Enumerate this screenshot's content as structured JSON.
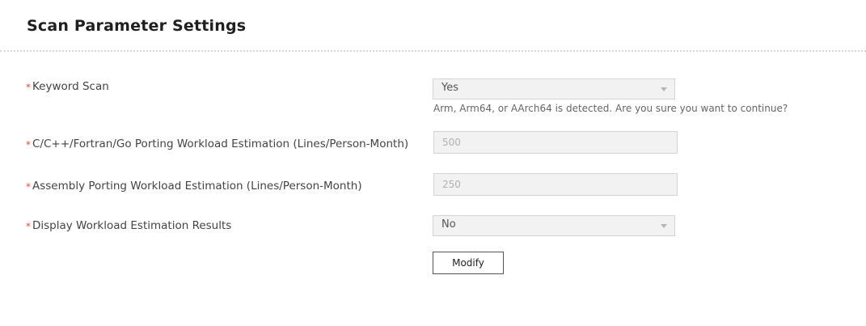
{
  "header": {
    "title": "Scan Parameter Settings"
  },
  "required_marker": "*",
  "form": {
    "keyword_scan": {
      "label": "Keyword Scan",
      "value": "Yes",
      "hint": "Arm, Arm64, or AArch64 is detected. Are you sure you want to continue?"
    },
    "c_workload": {
      "label": "C/C++/Fortran/Go Porting Workload Estimation (Lines/Person-Month)",
      "value": "500"
    },
    "asm_workload": {
      "label": "Assembly Porting Workload Estimation (Lines/Person-Month)",
      "value": "250"
    },
    "display_results": {
      "label": "Display Workload Estimation Results",
      "value": "No"
    },
    "modify_label": "Modify"
  },
  "icons": {
    "dropdown": "chevron-down-icon"
  },
  "colors": {
    "required": "#e74c3c",
    "disabled_bg": "#f2f2f2",
    "border": "#d4d4d4"
  }
}
